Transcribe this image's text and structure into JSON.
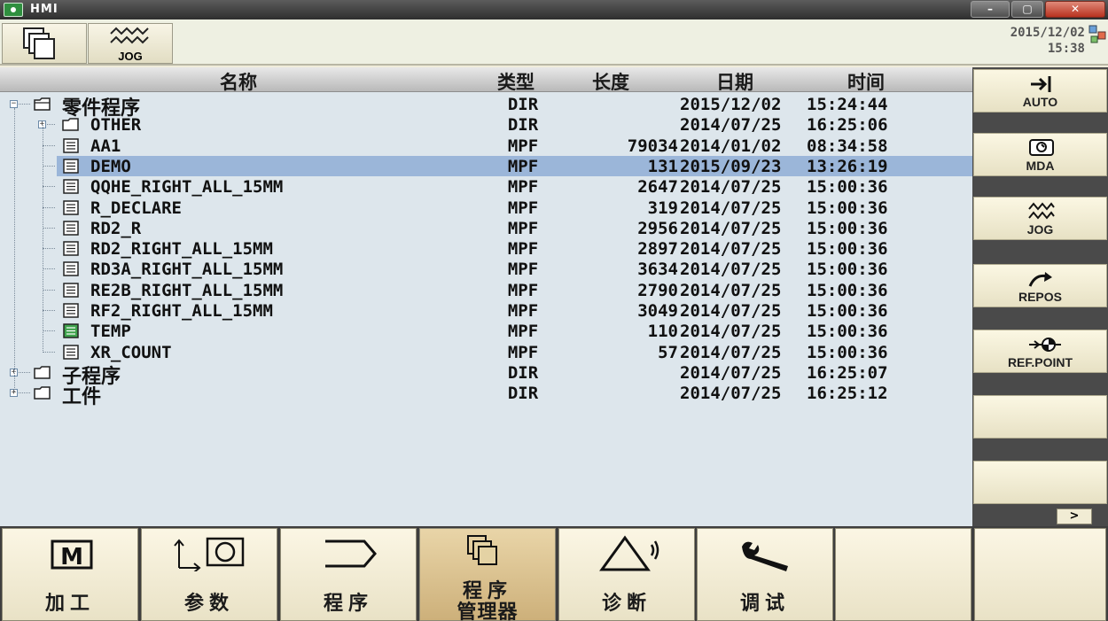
{
  "window": {
    "title": "HMI"
  },
  "header": {
    "jog_label": "JOG",
    "date": "2015/12/02",
    "time": "15:38"
  },
  "columns": {
    "name": "名称",
    "type": "类型",
    "length": "长度",
    "date": "日期",
    "time": "时间"
  },
  "files": [
    {
      "name": "零件程序",
      "type": "DIR",
      "length": "",
      "date": "2015/12/02",
      "time": "15:24:44",
      "level": 0,
      "kind": "folder-open",
      "expander": "-"
    },
    {
      "name": "OTHER",
      "type": "DIR",
      "length": "",
      "date": "2014/07/25",
      "time": "16:25:06",
      "level": 1,
      "kind": "folder",
      "expander": "+"
    },
    {
      "name": "AA1",
      "type": "MPF",
      "length": "79034",
      "date": "2014/01/02",
      "time": "08:34:58",
      "level": 1,
      "kind": "file"
    },
    {
      "name": "DEMO",
      "type": "MPF",
      "length": "131",
      "date": "2015/09/23",
      "time": "13:26:19",
      "level": 1,
      "kind": "file",
      "selected": true
    },
    {
      "name": "QQHE_RIGHT_ALL_15MM",
      "type": "MPF",
      "length": "2647",
      "date": "2014/07/25",
      "time": "15:00:36",
      "level": 1,
      "kind": "file"
    },
    {
      "name": "R_DECLARE",
      "type": "MPF",
      "length": "319",
      "date": "2014/07/25",
      "time": "15:00:36",
      "level": 1,
      "kind": "file"
    },
    {
      "name": "RD2_R",
      "type": "MPF",
      "length": "2956",
      "date": "2014/07/25",
      "time": "15:00:36",
      "level": 1,
      "kind": "file"
    },
    {
      "name": "RD2_RIGHT_ALL_15MM",
      "type": "MPF",
      "length": "2897",
      "date": "2014/07/25",
      "time": "15:00:36",
      "level": 1,
      "kind": "file"
    },
    {
      "name": "RD3A_RIGHT_ALL_15MM",
      "type": "MPF",
      "length": "3634",
      "date": "2014/07/25",
      "time": "15:00:36",
      "level": 1,
      "kind": "file"
    },
    {
      "name": "RE2B_RIGHT_ALL_15MM",
      "type": "MPF",
      "length": "2790",
      "date": "2014/07/25",
      "time": "15:00:36",
      "level": 1,
      "kind": "file"
    },
    {
      "name": "RF2_RIGHT_ALL_15MM",
      "type": "MPF",
      "length": "3049",
      "date": "2014/07/25",
      "time": "15:00:36",
      "level": 1,
      "kind": "file"
    },
    {
      "name": "TEMP",
      "type": "MPF",
      "length": "110",
      "date": "2014/07/25",
      "time": "15:00:36",
      "level": 1,
      "kind": "file-active"
    },
    {
      "name": "XR_COUNT",
      "type": "MPF",
      "length": "57",
      "date": "2014/07/25",
      "time": "15:00:36",
      "level": 1,
      "kind": "file"
    },
    {
      "name": "子程序",
      "type": "DIR",
      "length": "",
      "date": "2014/07/25",
      "time": "16:25:07",
      "level": 0,
      "kind": "folder",
      "expander": "+"
    },
    {
      "name": "工件",
      "type": "DIR",
      "length": "",
      "date": "2014/07/25",
      "time": "16:25:12",
      "level": 0,
      "kind": "folder",
      "expander": "+"
    }
  ],
  "softkeys": [
    {
      "label": "AUTO",
      "icon": "auto-icon"
    },
    {
      "label": "MDA",
      "icon": "mda-icon"
    },
    {
      "label": "JOG",
      "icon": "jog-icon"
    },
    {
      "label": "REPOS",
      "icon": "repos-icon"
    },
    {
      "label": "REF.POINT",
      "icon": "ref-point-icon"
    },
    {
      "label": "",
      "icon": ""
    },
    {
      "label": "",
      "icon": ""
    }
  ],
  "more_label": ">",
  "tabs": [
    {
      "label": "加工",
      "icon": "machine-icon"
    },
    {
      "label": "参数",
      "icon": "parameter-icon"
    },
    {
      "label": "程序",
      "icon": "program-icon"
    },
    {
      "label": "程序管理器",
      "line1": "程序",
      "line2": "管理器",
      "icon": "program-manager-icon",
      "active": true
    },
    {
      "label": "诊断",
      "icon": "diagnosis-icon"
    },
    {
      "label": "调试",
      "icon": "setup-icon"
    },
    {
      "label": "",
      "icon": ""
    },
    {
      "label": "",
      "icon": ""
    }
  ],
  "colors": {
    "selected_row": "#9bb6d9",
    "list_bg": "#dde6ec",
    "active_tab": "#d9bf8c"
  }
}
